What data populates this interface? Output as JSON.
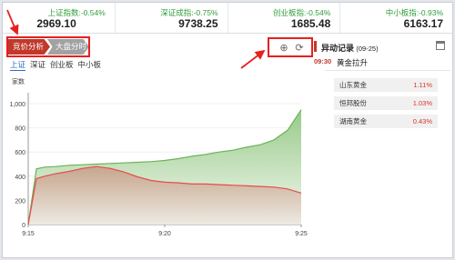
{
  "ticker": [
    {
      "name": "上证指数:-0.54%",
      "value": "2969.10"
    },
    {
      "name": "深证成指:-0.75%",
      "value": "9738.25"
    },
    {
      "name": "创业板指:-0.54%",
      "value": "1685.48"
    },
    {
      "name": "中小板指:-0.93%",
      "value": "6163.17"
    }
  ],
  "tabs": {
    "active": "竞价分析",
    "other": "大盘分时"
  },
  "subtabs": [
    "上证",
    "深证",
    "创业板",
    "中小板"
  ],
  "toolbar": {
    "zoom_icon": "⊕",
    "refresh_icon": "⟳"
  },
  "colors": {
    "up_line": "#6bb35a",
    "down_line": "#e84b4b",
    "accent": "#c0392b",
    "annotation": "#e81f1f"
  },
  "panel": {
    "title": "异动记录",
    "date": "(09-25)",
    "time": "09:30",
    "event": "黄金拉升",
    "stocks": [
      {
        "name": "山东黄金",
        "change": "1.11%"
      },
      {
        "name": "恒邦股份",
        "change": "1.03%"
      },
      {
        "name": "湖南黄金",
        "change": "0.43%"
      }
    ]
  },
  "chart_data": {
    "type": "area",
    "ylabel": "家数",
    "ylim": [
      0,
      1000
    ],
    "yticks": [
      0,
      200,
      400,
      600,
      800,
      1000
    ],
    "ytick_labels": [
      "0",
      "200",
      "400",
      "600",
      "800",
      "1,000"
    ],
    "xticks": [
      "9:15",
      "9:20",
      "9:25"
    ],
    "x_minutes": [
      0,
      0.3,
      0.6,
      1,
      1.5,
      2,
      2.5,
      3,
      3.5,
      4,
      4.5,
      5,
      5.5,
      6,
      6.5,
      7,
      7.5,
      8,
      8.5,
      9,
      9.5,
      10
    ],
    "series": [
      {
        "values": [
          0,
          460,
          475,
          480,
          490,
          495,
          500,
          505,
          510,
          515,
          520,
          530,
          545,
          565,
          580,
          600,
          615,
          640,
          660,
          700,
          780,
          950
        ]
      },
      {
        "values": [
          0,
          380,
          400,
          420,
          440,
          465,
          480,
          465,
          435,
          395,
          365,
          350,
          345,
          335,
          335,
          330,
          325,
          320,
          315,
          310,
          295,
          260
        ]
      }
    ]
  }
}
